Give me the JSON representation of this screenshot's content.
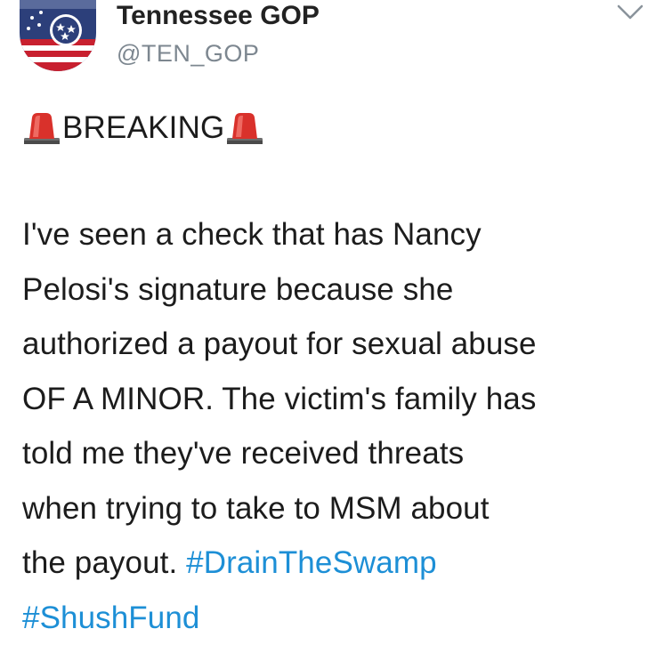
{
  "author": {
    "display_name": "Tennessee GOP",
    "handle": "@TEN_GOP",
    "avatar_icon": "tennessee-flag-avatar-icon"
  },
  "header": {
    "caret_icon": "chevron-down-icon"
  },
  "tweet": {
    "heading_icon": "rotating-light-emoji-icon",
    "heading": "BREAKING",
    "body_lines": [
      "I've seen a check that has Nancy",
      "Pelosi's signature because she",
      "authorized a payout for sexual abuse",
      "OF A MINOR. The victim's family has",
      "told me they've received threats",
      "when trying to take to MSM about"
    ],
    "last_line_prefix": "the payout. ",
    "hashtags": [
      "#DrainTheSwamp",
      "#ShushFund"
    ]
  },
  "colors": {
    "text": "#1c1c1c",
    "handle": "#7d8790",
    "hashtag": "#1d8fd6",
    "siren_red": "#d9312b"
  }
}
